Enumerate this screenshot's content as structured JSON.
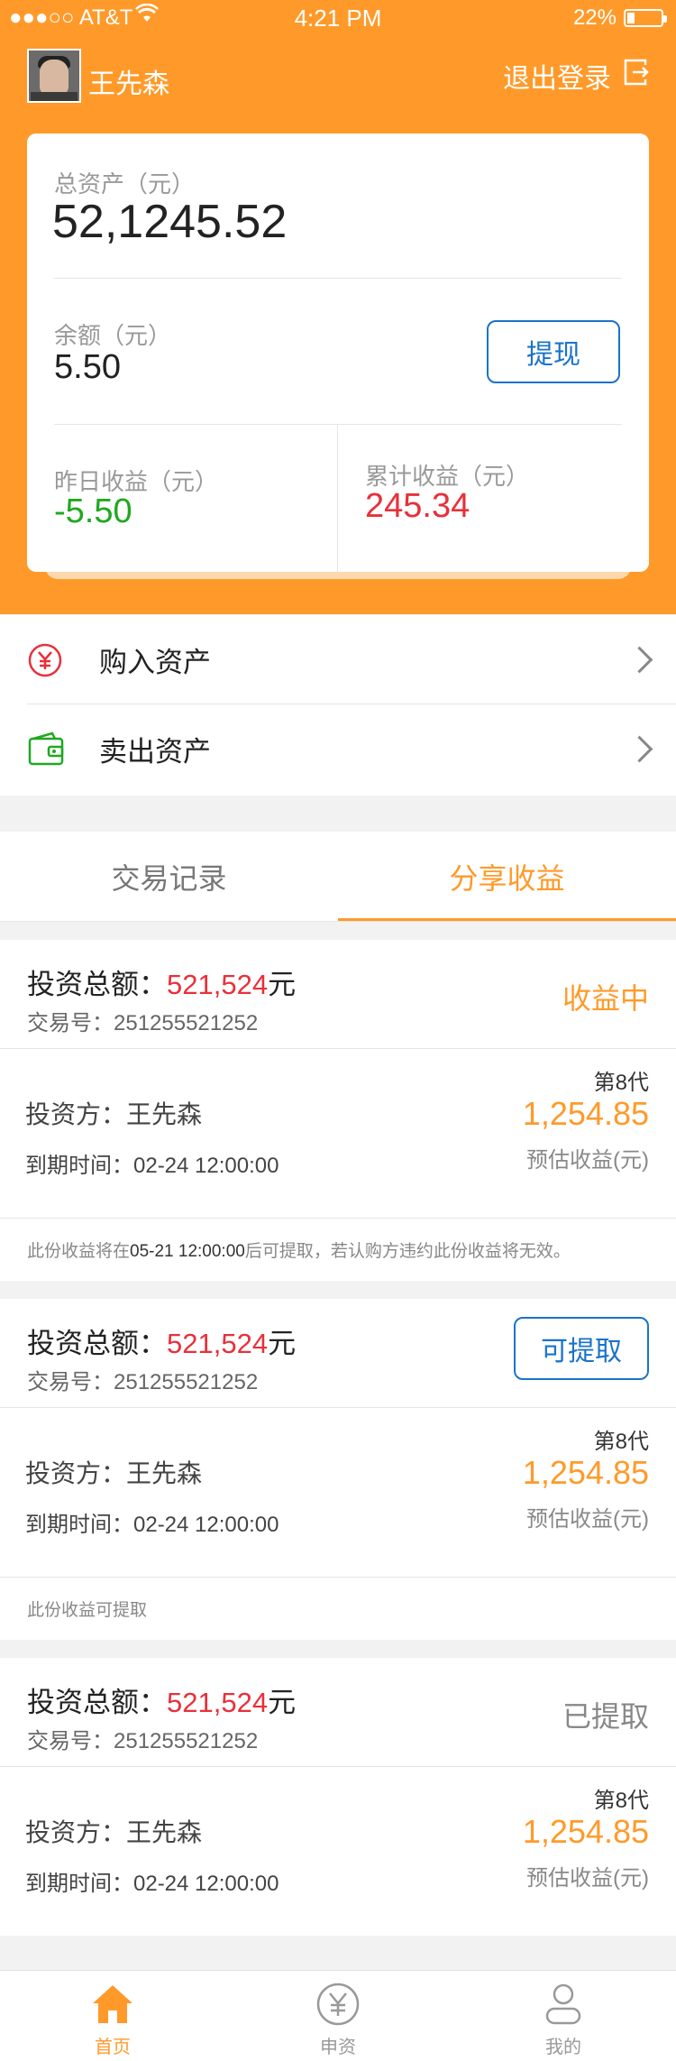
{
  "status_bar": {
    "carrier": "●●●○○ AT&T",
    "time": "4:21 PM",
    "battery": "22%",
    "battery_level": 0.22
  },
  "header": {
    "user_name": "王先森",
    "logout_label": "退出登录"
  },
  "assets": {
    "total_label": "总资产（元）",
    "total_value": "52,1245.52",
    "balance_label": "余额（元）",
    "balance_value": "5.50",
    "withdraw_label": "提现",
    "yesterday_label": "昨日收益（元）",
    "yesterday_value": "-5.50",
    "cumulative_label": "累计收益（元）",
    "cumulative_value": "245.34"
  },
  "menu": {
    "buy_label": "购入资产",
    "sell_label": "卖出资产"
  },
  "tabs": {
    "records_label": "交易记录",
    "share_label": "分享收益"
  },
  "records": [
    {
      "title_prefix": "投资总额：",
      "amount": "521,524",
      "unit": "元",
      "txn": "交易号：251255521252",
      "status": "收益中",
      "investor": "投资方：王先森",
      "due": "到期时间：02-24 12:00:00",
      "generation": "第8代",
      "profit": "1,254.85",
      "profit_label": "预估收益(元)",
      "note_pre": "此份收益将在",
      "note_time": "05-21 12:00:00",
      "note_post": "后可提取，若认购方违约此份收益将无效。"
    },
    {
      "title_prefix": "投资总额：",
      "amount": "521,524",
      "unit": "元",
      "txn": "交易号：251255521252",
      "status": "可提取",
      "investor": "投资方：王先森",
      "due": "到期时间：02-24 12:00:00",
      "generation": "第8代",
      "profit": "1,254.85",
      "profit_label": "预估收益(元)",
      "note": "此份收益可提取"
    },
    {
      "title_prefix": "投资总额：",
      "amount": "521,524",
      "unit": "元",
      "txn": "交易号：251255521252",
      "status": "已提取",
      "investor": "投资方：王先森",
      "due": "到期时间：02-24 12:00:00",
      "generation": "第8代",
      "profit": "1,254.85",
      "profit_label": "预估收益(元)"
    }
  ],
  "bottom_nav": {
    "home": "首页",
    "invest": "申资",
    "mine": "我的"
  },
  "colors": {
    "orange": "#ff9a2a",
    "blue": "#1a73c9",
    "red": "#e8303a",
    "green": "#20a820"
  }
}
